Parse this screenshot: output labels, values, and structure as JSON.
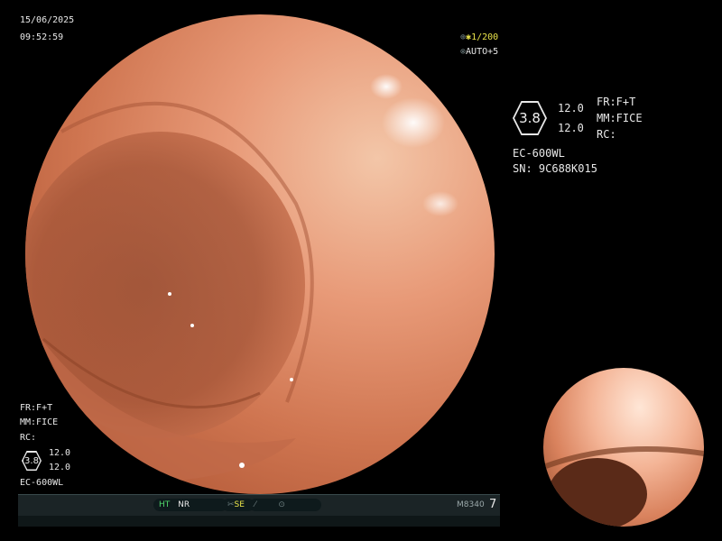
{
  "timestamp": {
    "date": "15/06/2025",
    "time": "09:52:59"
  },
  "top_right": {
    "shutter": "1/200",
    "auto": "AUTO+5"
  },
  "info_right": {
    "badge": "3.8",
    "val1": "12.0",
    "val2": "12.0",
    "fr": "FR:F+T",
    "mm": "MM:FICE",
    "rc": "RC:",
    "scope_model": "EC-600WL",
    "serial": "SN: 9C688K015"
  },
  "info_left": {
    "fr": "FR:F+T",
    "mm": "MM:FICE",
    "rc": "RC:",
    "badge": "3.8",
    "val1": "12.0",
    "val2": "12.0",
    "scope_model": "EC-600WL"
  },
  "statusbar": {
    "ht": "HT",
    "nr": "NR",
    "se": "SE",
    "code": "M8340",
    "number": "7"
  },
  "colors": {
    "green": "#4fd86a",
    "yellow": "#e9e34a"
  }
}
